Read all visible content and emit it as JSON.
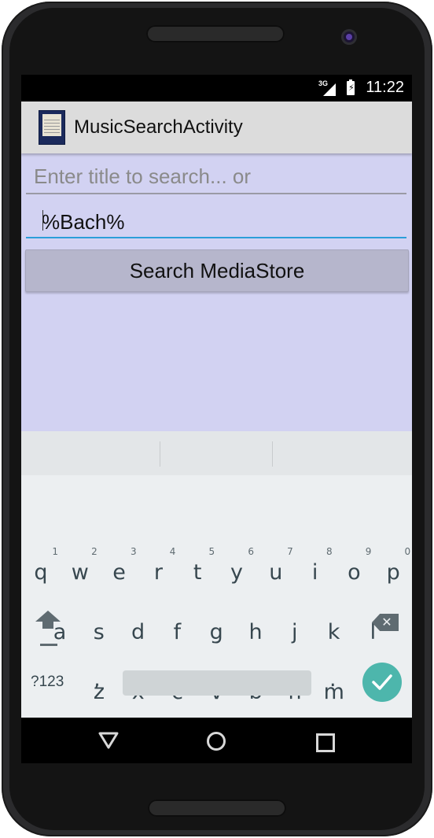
{
  "status_bar": {
    "network": "3G",
    "time": "11:22"
  },
  "action_bar": {
    "title": "MusicSearchActivity",
    "icon": "album-cover-icon"
  },
  "form": {
    "title_placeholder": "Enter title to search... or",
    "query_value": "%Bach%",
    "search_button_label": "Search MediaStore"
  },
  "keyboard": {
    "row1": [
      {
        "key": "q",
        "hint": "1"
      },
      {
        "key": "w",
        "hint": "2"
      },
      {
        "key": "e",
        "hint": "3"
      },
      {
        "key": "r",
        "hint": "4"
      },
      {
        "key": "t",
        "hint": "5"
      },
      {
        "key": "y",
        "hint": "6"
      },
      {
        "key": "u",
        "hint": "7"
      },
      {
        "key": "i",
        "hint": "8"
      },
      {
        "key": "o",
        "hint": "9"
      },
      {
        "key": "p",
        "hint": "0"
      }
    ],
    "row2": [
      "a",
      "s",
      "d",
      "f",
      "g",
      "h",
      "j",
      "k",
      "l"
    ],
    "row3": [
      "z",
      "x",
      "c",
      "v",
      "b",
      "n",
      "m"
    ],
    "symbols_label": "?123",
    "comma": ",",
    "period": ".",
    "enter_icon": "checkmark-icon",
    "shift_icon": "shift-icon",
    "backspace_icon": "backspace-icon"
  },
  "nav_bar": {
    "back_icon": "back-triangle-icon",
    "home_icon": "home-circle-icon",
    "recents_icon": "recents-square-icon"
  },
  "colors": {
    "content_bg": "#d2d2f2",
    "accent": "#2b9ed9",
    "enter": "#4db6ac"
  }
}
